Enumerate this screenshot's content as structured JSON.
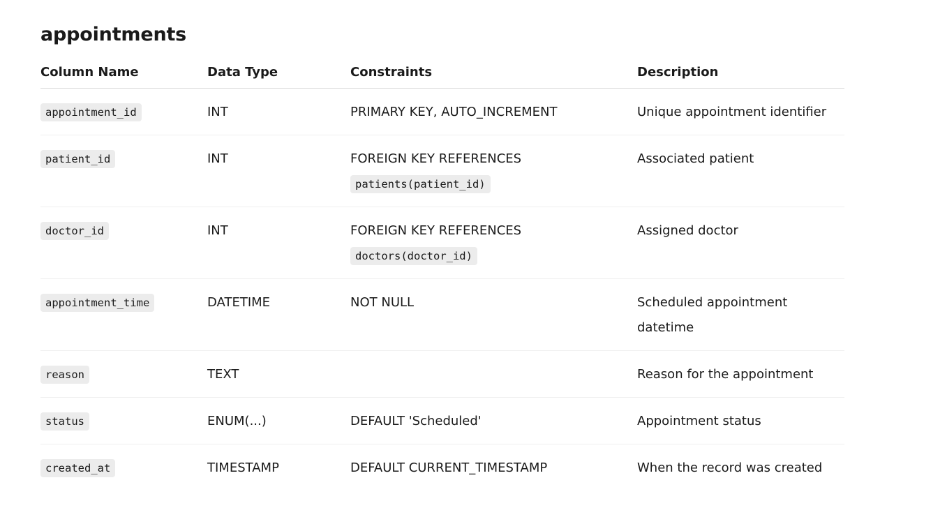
{
  "title": "appointments",
  "headers": {
    "column_name": "Column Name",
    "data_type": "Data Type",
    "constraints": "Constraints",
    "description": "Description"
  },
  "rows": [
    {
      "column": "appointment_id",
      "type": "INT",
      "constraint_text": "PRIMARY KEY, AUTO_INCREMENT",
      "constraint_code": "",
      "description": "Unique appointment identifier"
    },
    {
      "column": "patient_id",
      "type": "INT",
      "constraint_text": "FOREIGN KEY REFERENCES",
      "constraint_code": "patients(patient_id)",
      "description": "Associated patient"
    },
    {
      "column": "doctor_id",
      "type": "INT",
      "constraint_text": "FOREIGN KEY REFERENCES",
      "constraint_code": "doctors(doctor_id)",
      "description": "Assigned doctor"
    },
    {
      "column": "appointment_time",
      "type": "DATETIME",
      "constraint_text": "NOT NULL",
      "constraint_code": "",
      "description": "Scheduled appointment datetime"
    },
    {
      "column": "reason",
      "type": "TEXT",
      "constraint_text": "",
      "constraint_code": "",
      "description": "Reason for the appointment"
    },
    {
      "column": "status",
      "type": "ENUM(...)",
      "constraint_text": "DEFAULT 'Scheduled'",
      "constraint_code": "",
      "description": "Appointment status"
    },
    {
      "column": "created_at",
      "type": "TIMESTAMP",
      "constraint_text": "DEFAULT CURRENT_TIMESTAMP",
      "constraint_code": "",
      "description": "When the record was created"
    }
  ]
}
